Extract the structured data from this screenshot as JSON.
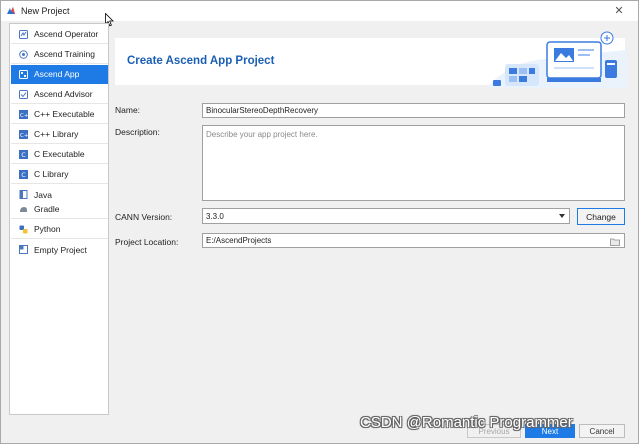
{
  "window": {
    "title": "New Project",
    "close_glyph": "✕"
  },
  "sidebar": {
    "items": [
      {
        "label": "Ascend Operator",
        "icon": "operator-icon"
      },
      {
        "label": "Ascend Training",
        "icon": "training-icon"
      },
      {
        "label": "Ascend App",
        "icon": "app-icon",
        "selected": true
      },
      {
        "label": "Ascend Advisor",
        "icon": "advisor-icon"
      },
      {
        "label": "C++ Executable",
        "icon": "cpp-icon"
      },
      {
        "label": "C++ Library",
        "icon": "cpp-icon"
      },
      {
        "label": "C Executable",
        "icon": "c-icon"
      },
      {
        "label": "C Library",
        "icon": "c-icon"
      },
      {
        "label": "Java",
        "icon": "java-icon"
      },
      {
        "label": "Gradle",
        "icon": "gradle-icon"
      },
      {
        "label": "Python",
        "icon": "python-icon"
      },
      {
        "label": "Empty Project",
        "icon": "empty-project-icon"
      }
    ]
  },
  "banner": {
    "title": "Create Ascend App Project"
  },
  "form": {
    "name_label": "Name:",
    "name_value": "BinocularStereoDepthRecovery",
    "description_label": "Description:",
    "description_placeholder": "Describe your app project here.",
    "cann_label": "CANN Version:",
    "cann_value": "3.3.0",
    "change_label": "Change",
    "location_label": "Project Location:",
    "location_value": "E:/AscendProjects"
  },
  "footer": {
    "previous_label": "Previous",
    "next_label": "Next",
    "cancel_label": "Cancel"
  },
  "watermark": {
    "text": "CSDN @Romantic Programmer"
  },
  "colors": {
    "accent": "#1e7be6",
    "banner_title": "#1a5fb4",
    "window_bg": "#f0f0f0"
  }
}
